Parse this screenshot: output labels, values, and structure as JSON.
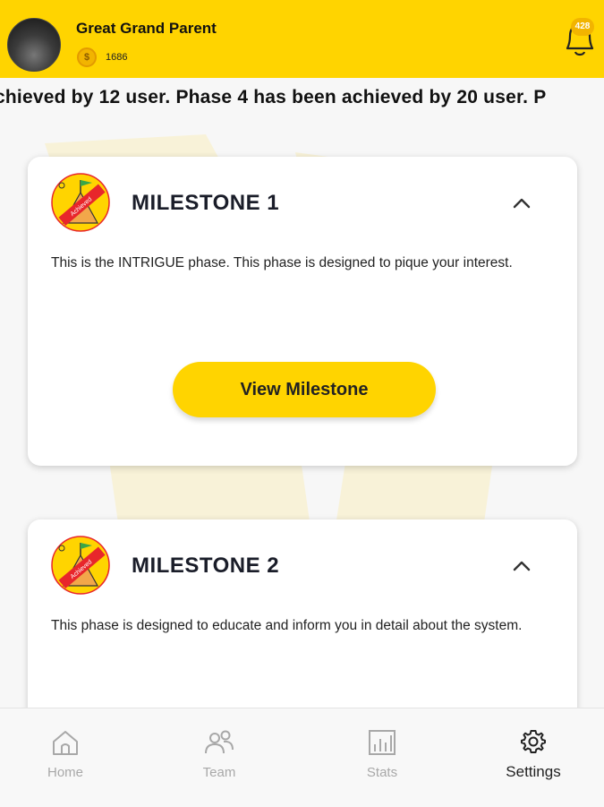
{
  "header": {
    "user_name": "Great Grand Parent",
    "coin_count": "1686",
    "coin_symbol": "$",
    "notification_count": "428"
  },
  "ticker": {
    "text": "chieved by 12 user. Phase 4 has been achieved by 20 user. P"
  },
  "milestones": [
    {
      "title": "MILESTONE 1",
      "description": "This is the INTRIGUE phase. This phase is designed to pique your interest.",
      "badge_label": "Achieved",
      "button_label": "View Milestone"
    },
    {
      "title": "MILESTONE 2",
      "description": "This phase is designed to educate and inform you in detail about the system.",
      "badge_label": "Achieved"
    }
  ],
  "nav": {
    "items": [
      {
        "label": "Home",
        "icon": "home-icon"
      },
      {
        "label": "Team",
        "icon": "team-icon"
      },
      {
        "label": "Stats",
        "icon": "stats-icon"
      },
      {
        "label": "Settings",
        "icon": "gear-icon",
        "active": true
      }
    ]
  },
  "colors": {
    "brand_yellow": "#ffd400",
    "coin_gold": "#f2b400",
    "badge_red": "#e8262b",
    "text_dark": "#1a1d29"
  }
}
